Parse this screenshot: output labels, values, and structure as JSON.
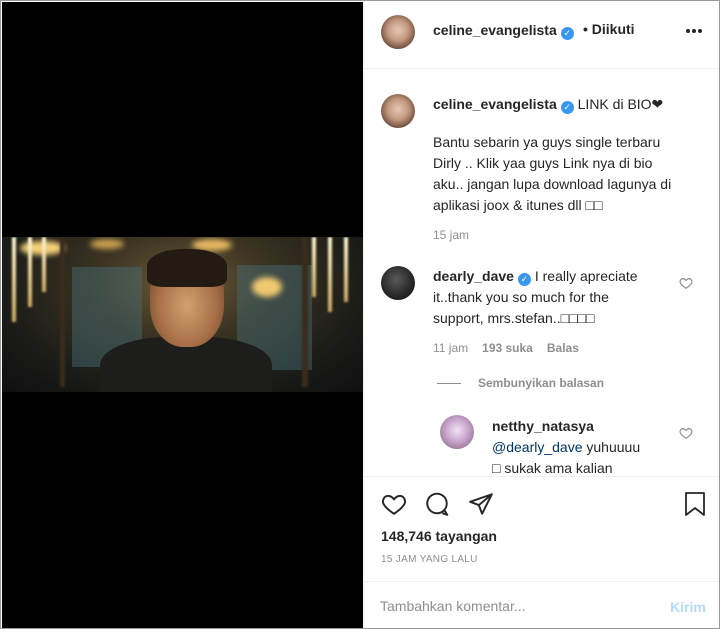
{
  "post": {
    "username": "celine_evangelista",
    "follow_status": "• Diikuti",
    "more_label": "•••"
  },
  "caption": {
    "username": "celine_evangelista",
    "title_text": "LINK di BIO❤",
    "body_lines": [
      "Bantu sebarin ya guys single terbaru",
      "Dirly .. Klik yaa guys Link nya di bio",
      "aku.. jangan lupa download lagunya di",
      "aplikasi joox & itunes dll □□"
    ],
    "time": "15 jam"
  },
  "comment1": {
    "username": "dearly_dave",
    "text_first": "I really apreciate",
    "lines": [
      "it..thank you so much for the",
      "support, mrs.stefan..□□□□"
    ],
    "time": "11 jam",
    "likes": "193 suka",
    "reply": "Balas",
    "hide_replies": "Sembunyikan balasan"
  },
  "reply1": {
    "username": "netthy_natasya",
    "mention": "@dearly_dave",
    "text_first": " yuhuuuu",
    "lines": [
      "□ sukak ama kalian"
    ]
  },
  "actions": {
    "views": "148,746 tayangan",
    "time_ago": "15 JAM YANG LALU"
  },
  "compose": {
    "placeholder": "Tambahkan komentar...",
    "send": "Kirim"
  },
  "colors": {
    "verified": "#3897f0",
    "muted": "#8e8e8e",
    "send_disabled": "#b3dbff",
    "mention": "#003569"
  },
  "icons": [
    "verified-badge-icon",
    "heart-icon",
    "comment-icon",
    "share-icon",
    "bookmark-icon",
    "more-icon"
  ]
}
